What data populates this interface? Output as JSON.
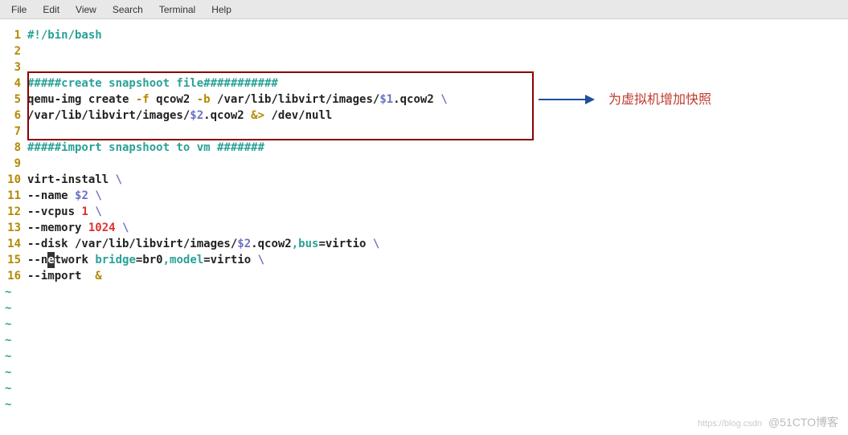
{
  "menubar": {
    "items": [
      "File",
      "Edit",
      "View",
      "Search",
      "Terminal",
      "Help"
    ]
  },
  "annotation": {
    "text": "为虚拟机增加快照"
  },
  "watermark": {
    "left": "https://blog.csdn",
    "right": "@51CTO博客"
  },
  "lines": [
    {
      "no": "1",
      "tokens": [
        {
          "cls": "c-comment",
          "t": "#!/bin/bash"
        }
      ]
    },
    {
      "no": "2",
      "tokens": []
    },
    {
      "no": "3",
      "tokens": []
    },
    {
      "no": "4",
      "tokens": [
        {
          "cls": "c-comment",
          "t": "#####create snapshoot file###########"
        }
      ]
    },
    {
      "no": "5",
      "tokens": [
        {
          "cls": "c-default",
          "t": "qemu-img create "
        },
        {
          "cls": "c-opt",
          "t": "-f"
        },
        {
          "cls": "c-default",
          "t": " qcow2 "
        },
        {
          "cls": "c-opt",
          "t": "-b"
        },
        {
          "cls": "c-default",
          "t": " /var/lib/libvirt/images/"
        },
        {
          "cls": "c-var",
          "t": "$1"
        },
        {
          "cls": "c-default",
          "t": ".qcow2 "
        },
        {
          "cls": "c-var",
          "t": "\\"
        }
      ]
    },
    {
      "no": "6",
      "tokens": [
        {
          "cls": "c-default",
          "t": "/var/lib/libvirt/images/"
        },
        {
          "cls": "c-var",
          "t": "$2"
        },
        {
          "cls": "c-default",
          "t": ".qcow2 "
        },
        {
          "cls": "c-op",
          "t": "&>"
        },
        {
          "cls": "c-default",
          "t": " /dev/null"
        }
      ]
    },
    {
      "no": "7",
      "tokens": []
    },
    {
      "no": "8",
      "tokens": [
        {
          "cls": "c-comment",
          "t": "#####import snapshoot to vm #######"
        }
      ]
    },
    {
      "no": "9",
      "tokens": []
    },
    {
      "no": "10",
      "tokens": [
        {
          "cls": "c-default",
          "t": "virt-install "
        },
        {
          "cls": "c-var",
          "t": "\\"
        }
      ]
    },
    {
      "no": "11",
      "tokens": [
        {
          "cls": "c-default",
          "t": "--name "
        },
        {
          "cls": "c-var",
          "t": "$2"
        },
        {
          "cls": "c-default",
          "t": " "
        },
        {
          "cls": "c-var",
          "t": "\\"
        }
      ]
    },
    {
      "no": "12",
      "tokens": [
        {
          "cls": "c-default",
          "t": "--vcpus "
        },
        {
          "cls": "c-num",
          "t": "1"
        },
        {
          "cls": "c-default",
          "t": " "
        },
        {
          "cls": "c-var",
          "t": "\\"
        }
      ]
    },
    {
      "no": "13",
      "tokens": [
        {
          "cls": "c-default",
          "t": "--memory "
        },
        {
          "cls": "c-num",
          "t": "1024"
        },
        {
          "cls": "c-default",
          "t": " "
        },
        {
          "cls": "c-var",
          "t": "\\"
        }
      ]
    },
    {
      "no": "14",
      "tokens": [
        {
          "cls": "c-default",
          "t": "--disk /var/lib/libvirt/images/"
        },
        {
          "cls": "c-var",
          "t": "$2"
        },
        {
          "cls": "c-default",
          "t": ".qcow2"
        },
        {
          "cls": "c-cmd",
          "t": ",bus"
        },
        {
          "cls": "c-default",
          "t": "=virtio "
        },
        {
          "cls": "c-var",
          "t": "\\"
        }
      ]
    },
    {
      "no": "15",
      "tokens": [
        {
          "cls": "c-default",
          "t": "--n"
        },
        {
          "cls": "cursor-block",
          "t": "e"
        },
        {
          "cls": "c-default",
          "t": "twork "
        },
        {
          "cls": "c-cmd",
          "t": "bridge"
        },
        {
          "cls": "c-default",
          "t": "=br0"
        },
        {
          "cls": "c-cmd",
          "t": ",model"
        },
        {
          "cls": "c-default",
          "t": "=virtio "
        },
        {
          "cls": "c-var",
          "t": "\\"
        }
      ]
    },
    {
      "no": "16",
      "tokens": [
        {
          "cls": "c-default",
          "t": "--import  "
        },
        {
          "cls": "c-op",
          "t": "&"
        }
      ]
    }
  ],
  "tilde_count": 8
}
